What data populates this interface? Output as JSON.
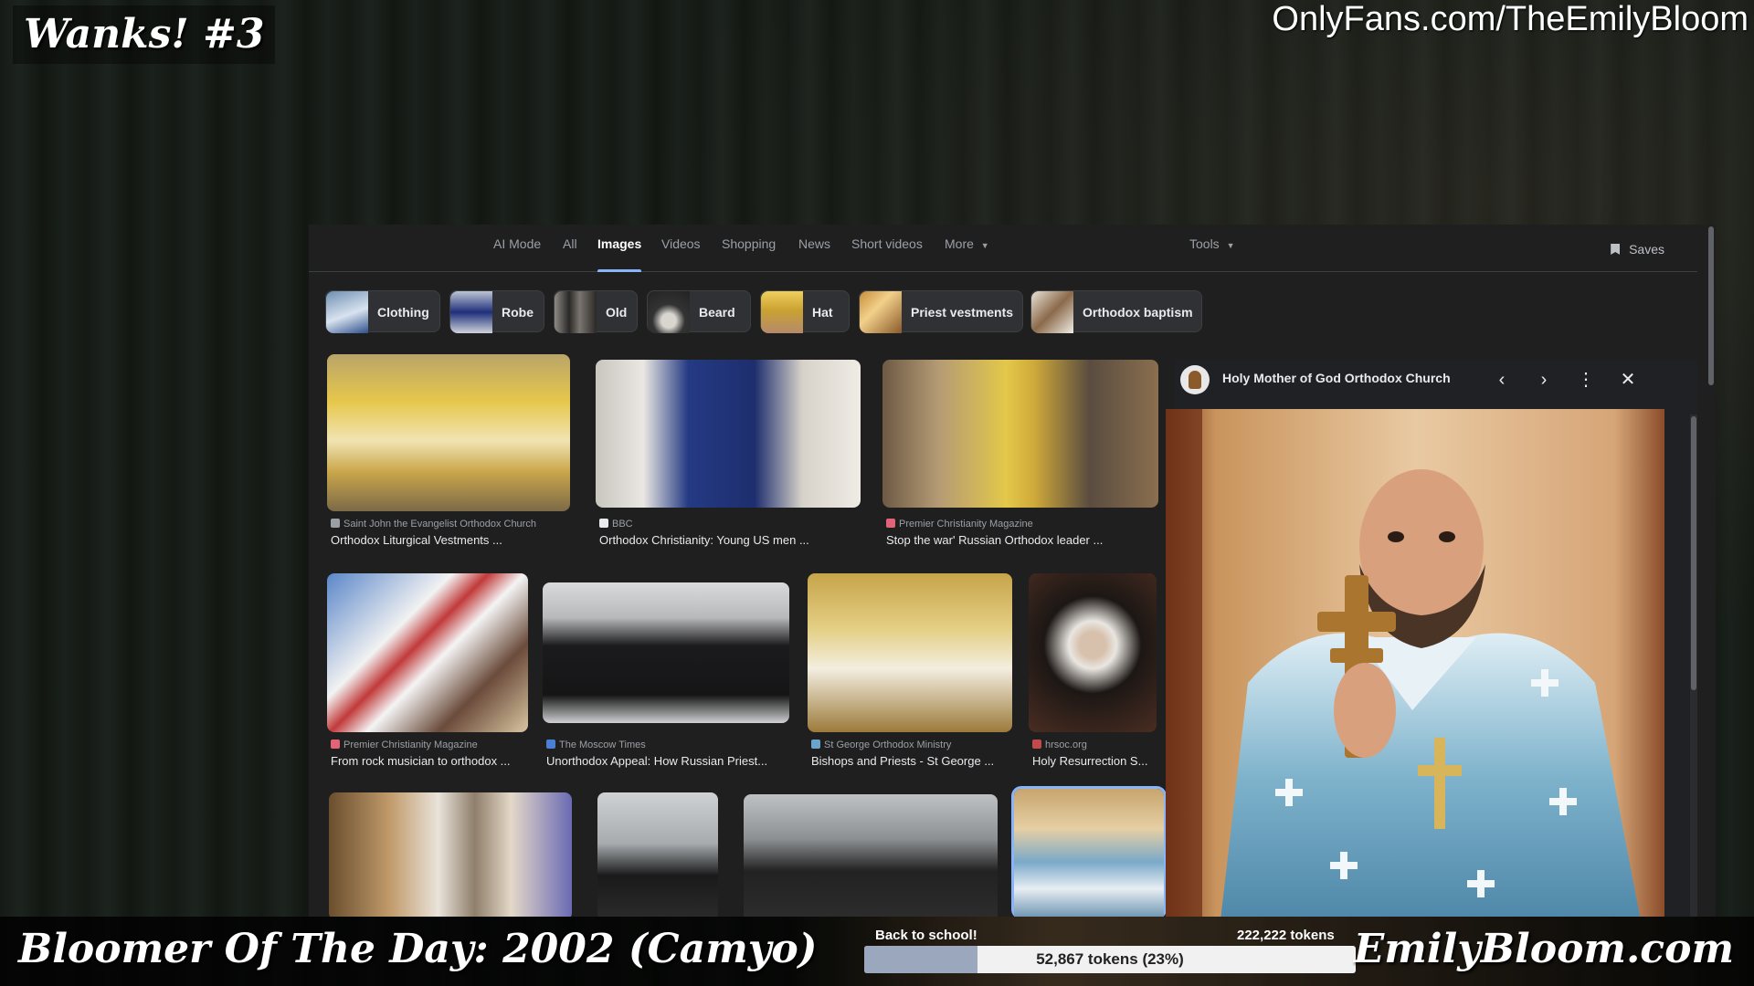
{
  "overlay": {
    "top_left_title": "Wanks! #3",
    "top_right_link": "OnlyFans.com/TheEmilyBloom",
    "bottom_left_text": "Bloomer Of The Day: 2002 (Camyo)",
    "bottom_right_site": "EmilyBloom.com",
    "goal": {
      "label": "Back to school!",
      "target": "222,222 tokens",
      "progress_text": "52,867 tokens (23%)",
      "progress_fraction": 0.23
    }
  },
  "search": {
    "tabs": [
      {
        "label": "AI Mode"
      },
      {
        "label": "All"
      },
      {
        "label": "Images",
        "active": true
      },
      {
        "label": "Videos"
      },
      {
        "label": "Shopping"
      },
      {
        "label": "News"
      },
      {
        "label": "Short videos"
      },
      {
        "label": "More"
      }
    ],
    "tools_label": "Tools",
    "saves_label": "Saves",
    "chips": [
      {
        "label": "Clothing"
      },
      {
        "label": "Robe"
      },
      {
        "label": "Old"
      },
      {
        "label": "Beard"
      },
      {
        "label": "Hat"
      },
      {
        "label": "Priest vestments"
      },
      {
        "label": "Orthodox baptism"
      }
    ],
    "results": [
      {
        "source": "Saint John the Evangelist Orthodox Church",
        "title": "Orthodox Liturgical Vestments ..."
      },
      {
        "source": "BBC",
        "title": "Orthodox Christianity: Young US men ..."
      },
      {
        "source": "Premier Christianity Magazine",
        "title": "Stop the war' Russian Orthodox leader ..."
      },
      {
        "source": "Premier Christianity Magazine",
        "title": "From rock musician to orthodox ..."
      },
      {
        "source": "The Moscow Times",
        "title": "Unorthodox Appeal: How Russian Priest..."
      },
      {
        "source": "St George Orthodox Ministry",
        "title": "Bishops and Priests - St George ..."
      },
      {
        "source": "hrsoc.org",
        "title": "Holy Resurrection S..."
      },
      {
        "source": "",
        "title": ""
      },
      {
        "source": "",
        "title": ""
      },
      {
        "source": "",
        "title": ""
      },
      {
        "source": "",
        "title": ""
      }
    ],
    "preview": {
      "site_name": "Holy Mother of God Orthodox Church"
    }
  },
  "icons": {
    "prev": "chevron-left-icon",
    "next": "chevron-right-icon",
    "menu": "more-vert-icon",
    "close": "close-icon",
    "saves": "bookmark-icon",
    "tools_dropdown": "caret-down-icon"
  },
  "colors": {
    "accent": "#8ab4f8",
    "background": "#1f1f1f",
    "chip": "#303134"
  }
}
